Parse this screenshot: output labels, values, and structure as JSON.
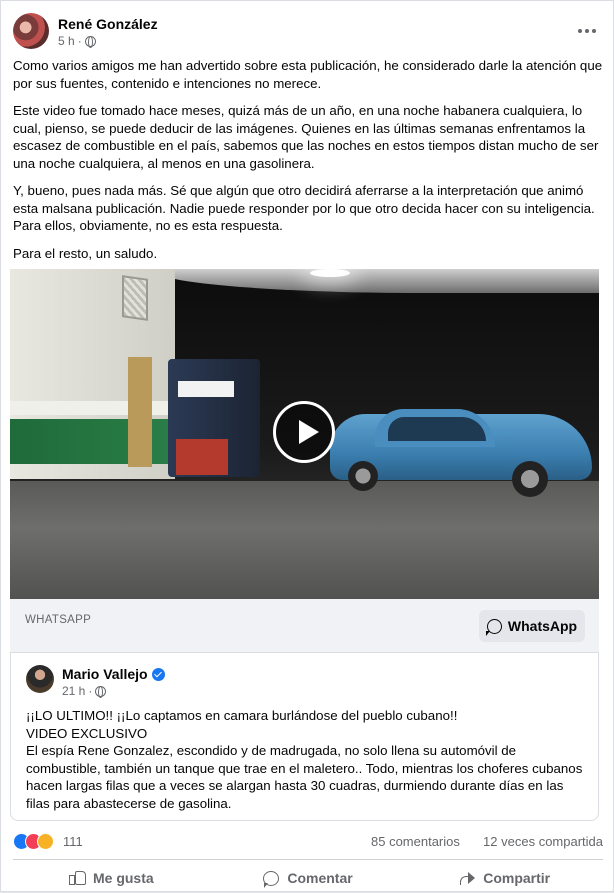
{
  "post": {
    "author": "René González",
    "time": "5 h",
    "paragraphs": [
      "Como varios amigos me han advertido sobre esta publicación, he considerado darle la atención que por sus fuentes, contenido e intenciones no merece.",
      "Este video fue tomado hace meses, quizá más de un año, en una noche habanera cualquiera, lo cual, pienso, se puede deducir de las imágenes. Quienes en las últimas semanas enfrentamos la escasez de combustible en el país, sabemos que las noches en estos tiempos distan mucho de ser una noche cualquiera, al menos en una gasolinera.",
      "Y, bueno, pues nada más. Sé que algún que otro decidirá aferrarse a la interpretación que animó esta malsana publicación. Nadie puede responder por lo que otro decida hacer con su inteligencia. Para ellos, obviamente, no es esta respuesta.",
      "Para el resto, un saludo."
    ]
  },
  "link": {
    "source": "WHATSAPP",
    "button_label": "WhatsApp"
  },
  "shared": {
    "author": "Mario Vallejo",
    "time": "21 h",
    "lines": [
      "¡¡LO ULTIMO!! ¡¡Lo captamos en camara burlándose del pueblo cubano!!",
      "VIDEO EXCLUSIVO",
      "El espía Rene Gonzalez, escondido y de madrugada,  no solo llena su automóvil de combustible, también  un tanque que trae en el maletero.. Todo, mientras los choferes cubanos hacen largas filas que a veces se alargan hasta 30 cuadras, durmiendo durante días en las filas para abastecerse de gasolina."
    ]
  },
  "stats": {
    "reactions": "111",
    "comments": "85 comentarios",
    "shares": "12 veces compartida"
  },
  "actions": {
    "like": "Me gusta",
    "comment": "Comentar",
    "share": "Compartir"
  },
  "icons": [
    "globe-icon",
    "more-options-icon",
    "play-icon",
    "whatsapp-icon",
    "verified-icon",
    "like-icon",
    "love-icon",
    "haha-icon",
    "thumb-icon",
    "comment-icon",
    "share-icon"
  ],
  "colors": {
    "accent": "#1877f2",
    "secondary_text": "#65676b"
  }
}
